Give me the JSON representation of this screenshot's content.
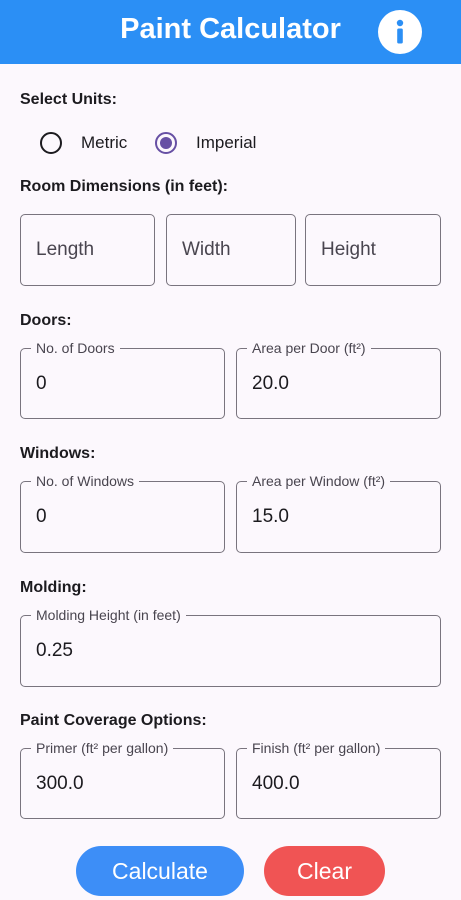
{
  "app": {
    "title": "Paint Calculator",
    "accent": "#2b8ff5",
    "info_icon": "info-icon"
  },
  "units": {
    "label": "Select Units:",
    "options": [
      "Metric",
      "Imperial"
    ],
    "selected": "Imperial"
  },
  "room": {
    "label": "Room Dimensions (in feet):",
    "length_placeholder": "Length",
    "width_placeholder": "Width",
    "height_placeholder": "Height"
  },
  "doors": {
    "label": "Doors:",
    "count_label": "No. of Doors",
    "count_value": "0",
    "area_label": "Area per Door (ft²)",
    "area_value": "20.0"
  },
  "windows": {
    "label": "Windows:",
    "count_label": "No. of Windows",
    "count_value": "0",
    "area_label": "Area per Window (ft²)",
    "area_value": "15.0"
  },
  "molding": {
    "label": "Molding:",
    "height_label": "Molding Height (in feet)",
    "height_value": "0.25"
  },
  "coverage": {
    "label": "Paint Coverage Options:",
    "primer_label": "Primer (ft² per gallon)",
    "primer_value": "300.0",
    "finish_label": "Finish (ft² per gallon)",
    "finish_value": "400.0"
  },
  "actions": {
    "calculate": "Calculate",
    "calculate_color": "#3d8ef7",
    "clear": "Clear",
    "clear_color": "#f05454"
  }
}
